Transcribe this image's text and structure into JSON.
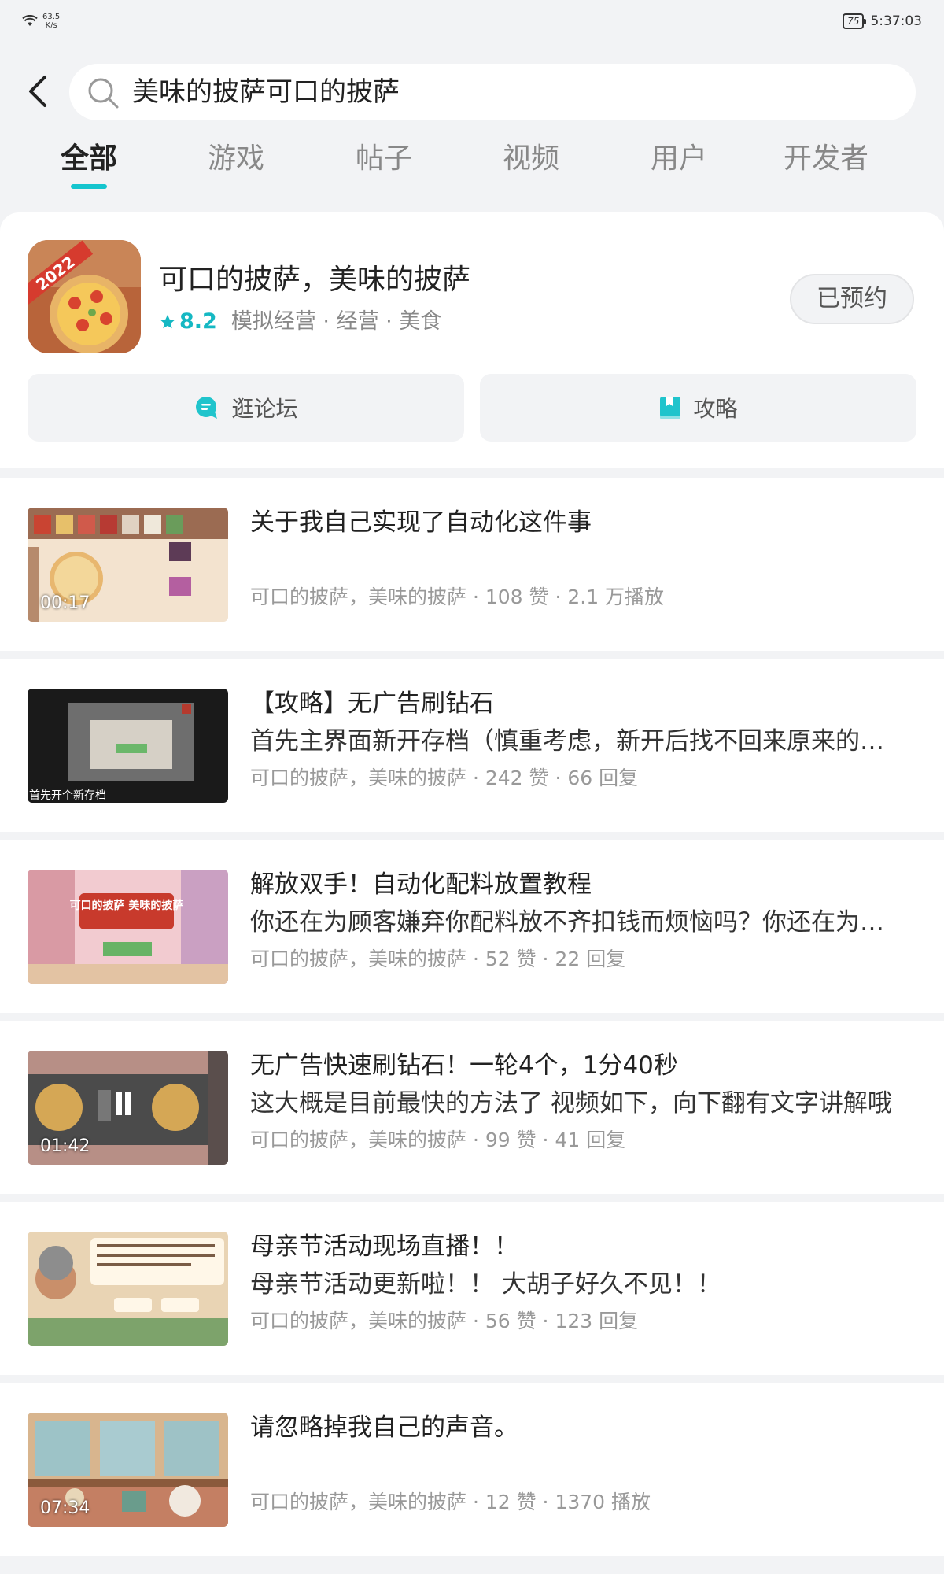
{
  "status_bar": {
    "net_speed_value": "63.5",
    "net_speed_unit": "K/s",
    "battery": "75",
    "time": "5:37:03"
  },
  "search": {
    "query": "美味的披萨可口的披萨"
  },
  "tabs": [
    {
      "label": "全部",
      "active": true
    },
    {
      "label": "游戏",
      "active": false
    },
    {
      "label": "帖子",
      "active": false
    },
    {
      "label": "视频",
      "active": false
    },
    {
      "label": "用户",
      "active": false
    },
    {
      "label": "开发者",
      "active": false
    }
  ],
  "game": {
    "icon_badge": "2022",
    "title": "可口的披萨，美味的披萨",
    "rating": "8.2",
    "tags": "模拟经营 · 经营 · 美食",
    "reserve_label": "已预约",
    "forum_label": "逛论坛",
    "guide_label": "攻略"
  },
  "feed": [
    {
      "title": "关于我自己实现了自动化这件事",
      "desc": "",
      "meta": "可口的披萨，美味的披萨 · 108 赞 · 2.1 万播放",
      "duration": "00:17"
    },
    {
      "title": "【攻略】无广告刷钻石",
      "desc": "首先主界面新开存档（慎重考虑，新开后找不回来原来的存档）",
      "meta": "可口的披萨，美味的披萨 · 242 赞 · 66 回复",
      "duration": "",
      "thumb_caption": "首先开个新存档"
    },
    {
      "title": "解放双手！自动化配料放置教程",
      "desc": "你还在为顾客嫌弃你配料放不齐扣钱而烦恼吗？你还在为刷钻石烦恼吗",
      "meta": "可口的披萨，美味的披萨 · 52 赞 · 22 回复",
      "duration": "",
      "thumb_caption": "可口的披萨 美味的披萨"
    },
    {
      "title": "无广告快速刷钻石！一轮4个，1分40秒",
      "desc": "这大概是目前最快的方法了 视频如下，向下翻有文字讲解哦",
      "meta": "可口的披萨，美味的披萨 · 99 赞 · 41 回复",
      "duration": "01:42"
    },
    {
      "title": "母亲节活动现场直播！！",
      "desc": "母亲节活动更新啦！！ 大胡子好久不见！！",
      "meta": "可口的披萨，美味的披萨 · 56 赞 · 123 回复",
      "duration": ""
    },
    {
      "title": "请忽略掉我自己的声音。",
      "desc": "",
      "meta": "可口的披萨，美味的披萨 · 12 赞 · 1370 播放",
      "duration": "07:34"
    }
  ],
  "colors": {
    "accent": "#15c5ce",
    "rating": "#15b8c3",
    "background": "#f2f3f5"
  }
}
